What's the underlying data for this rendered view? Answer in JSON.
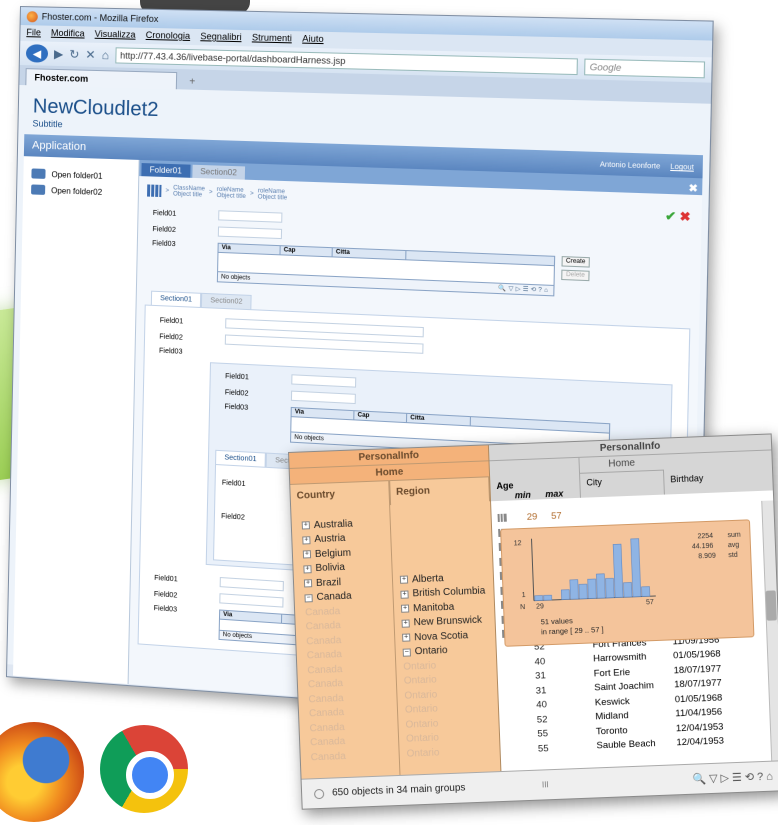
{
  "browser": {
    "window_title": "Fhoster.com - Mozilla Firefox",
    "menu": [
      "File",
      "Modifica",
      "Visualizza",
      "Cronologia",
      "Segnalibri",
      "Strumenti",
      "Aiuto"
    ],
    "url": "http://77.43.4.36/livebase-portal/dashboardHarness.jsp",
    "search_placeholder": "Google",
    "tab_title": "Fhoster.com",
    "new_tab": "+"
  },
  "app": {
    "title": "NewCloudlet2",
    "subtitle": "Subtitle",
    "bar_title": "Application",
    "user": "Antonio Leonforte",
    "logout": "Logout",
    "folders": [
      "Open folder01",
      "Open folder02"
    ],
    "tabs": [
      "Folder01",
      "Section02"
    ],
    "close_glyph": "✖",
    "crumbs": [
      {
        "name": "ClassName",
        "sub": "Object title"
      },
      {
        "name": "roleName",
        "sub": "Object title"
      },
      {
        "name": "roleName",
        "sub": "Object title"
      }
    ],
    "fields": [
      "Field01",
      "Field02",
      "Field03"
    ],
    "grid_cols": [
      "Via",
      "Cap",
      "Citta"
    ],
    "no_objects": "No objects",
    "create": "Create",
    "delete": "Delete",
    "section_tabs": [
      "Section01",
      "Section02"
    ]
  },
  "panel": {
    "group_header": "PersonalInfo",
    "home": "Home",
    "country_col": "Country",
    "region_col": "Region",
    "age_col": "Age",
    "min": "min",
    "max": "max",
    "city_col": "City",
    "birthday_col": "Birthday",
    "countries": [
      "Australia",
      "Austria",
      "Belgium",
      "Bolivia",
      "Brazil",
      "Canada"
    ],
    "canada_repeat": "Canada",
    "regions": [
      "Alberta",
      "British Columbia",
      "Manitoba",
      "New Brunswick",
      "Nova Scotia",
      "Ontario"
    ],
    "ontario_repeat": "Ontario",
    "age_min": "29",
    "age_max": "57",
    "ages": [
      "52",
      "40",
      "31",
      "31",
      "40",
      "52",
      "55",
      "55"
    ],
    "cities": [
      "Fort Frances",
      "Harrowsmith",
      "Fort Erie",
      "Saint Joachim",
      "Keswick",
      "Midland",
      "Toronto",
      "Sauble Beach"
    ],
    "birthdays": [
      "11/09/1956",
      "01/05/1968",
      "18/07/1977",
      "18/07/1977",
      "01/05/1968",
      "11/04/1956",
      "12/04/1953",
      "12/04/1953"
    ],
    "footer": "650 objects in 34 main groups",
    "scroll_grip": "III"
  },
  "histogram": {
    "ymax_label": "12",
    "ymin_label": "1",
    "n_label": "N",
    "x_min": "29",
    "x_max": "57",
    "sum": "2254",
    "sum_label": "sum",
    "avg": "44.196",
    "avg_label": "avg",
    "std": "8.909",
    "std_label": "std",
    "values_text": "51 values",
    "range_text": "in range [ 29 .. 57 ]",
    "bars": [
      1,
      1,
      0,
      2,
      4,
      3,
      4,
      5,
      4,
      11,
      3,
      12,
      2
    ]
  }
}
